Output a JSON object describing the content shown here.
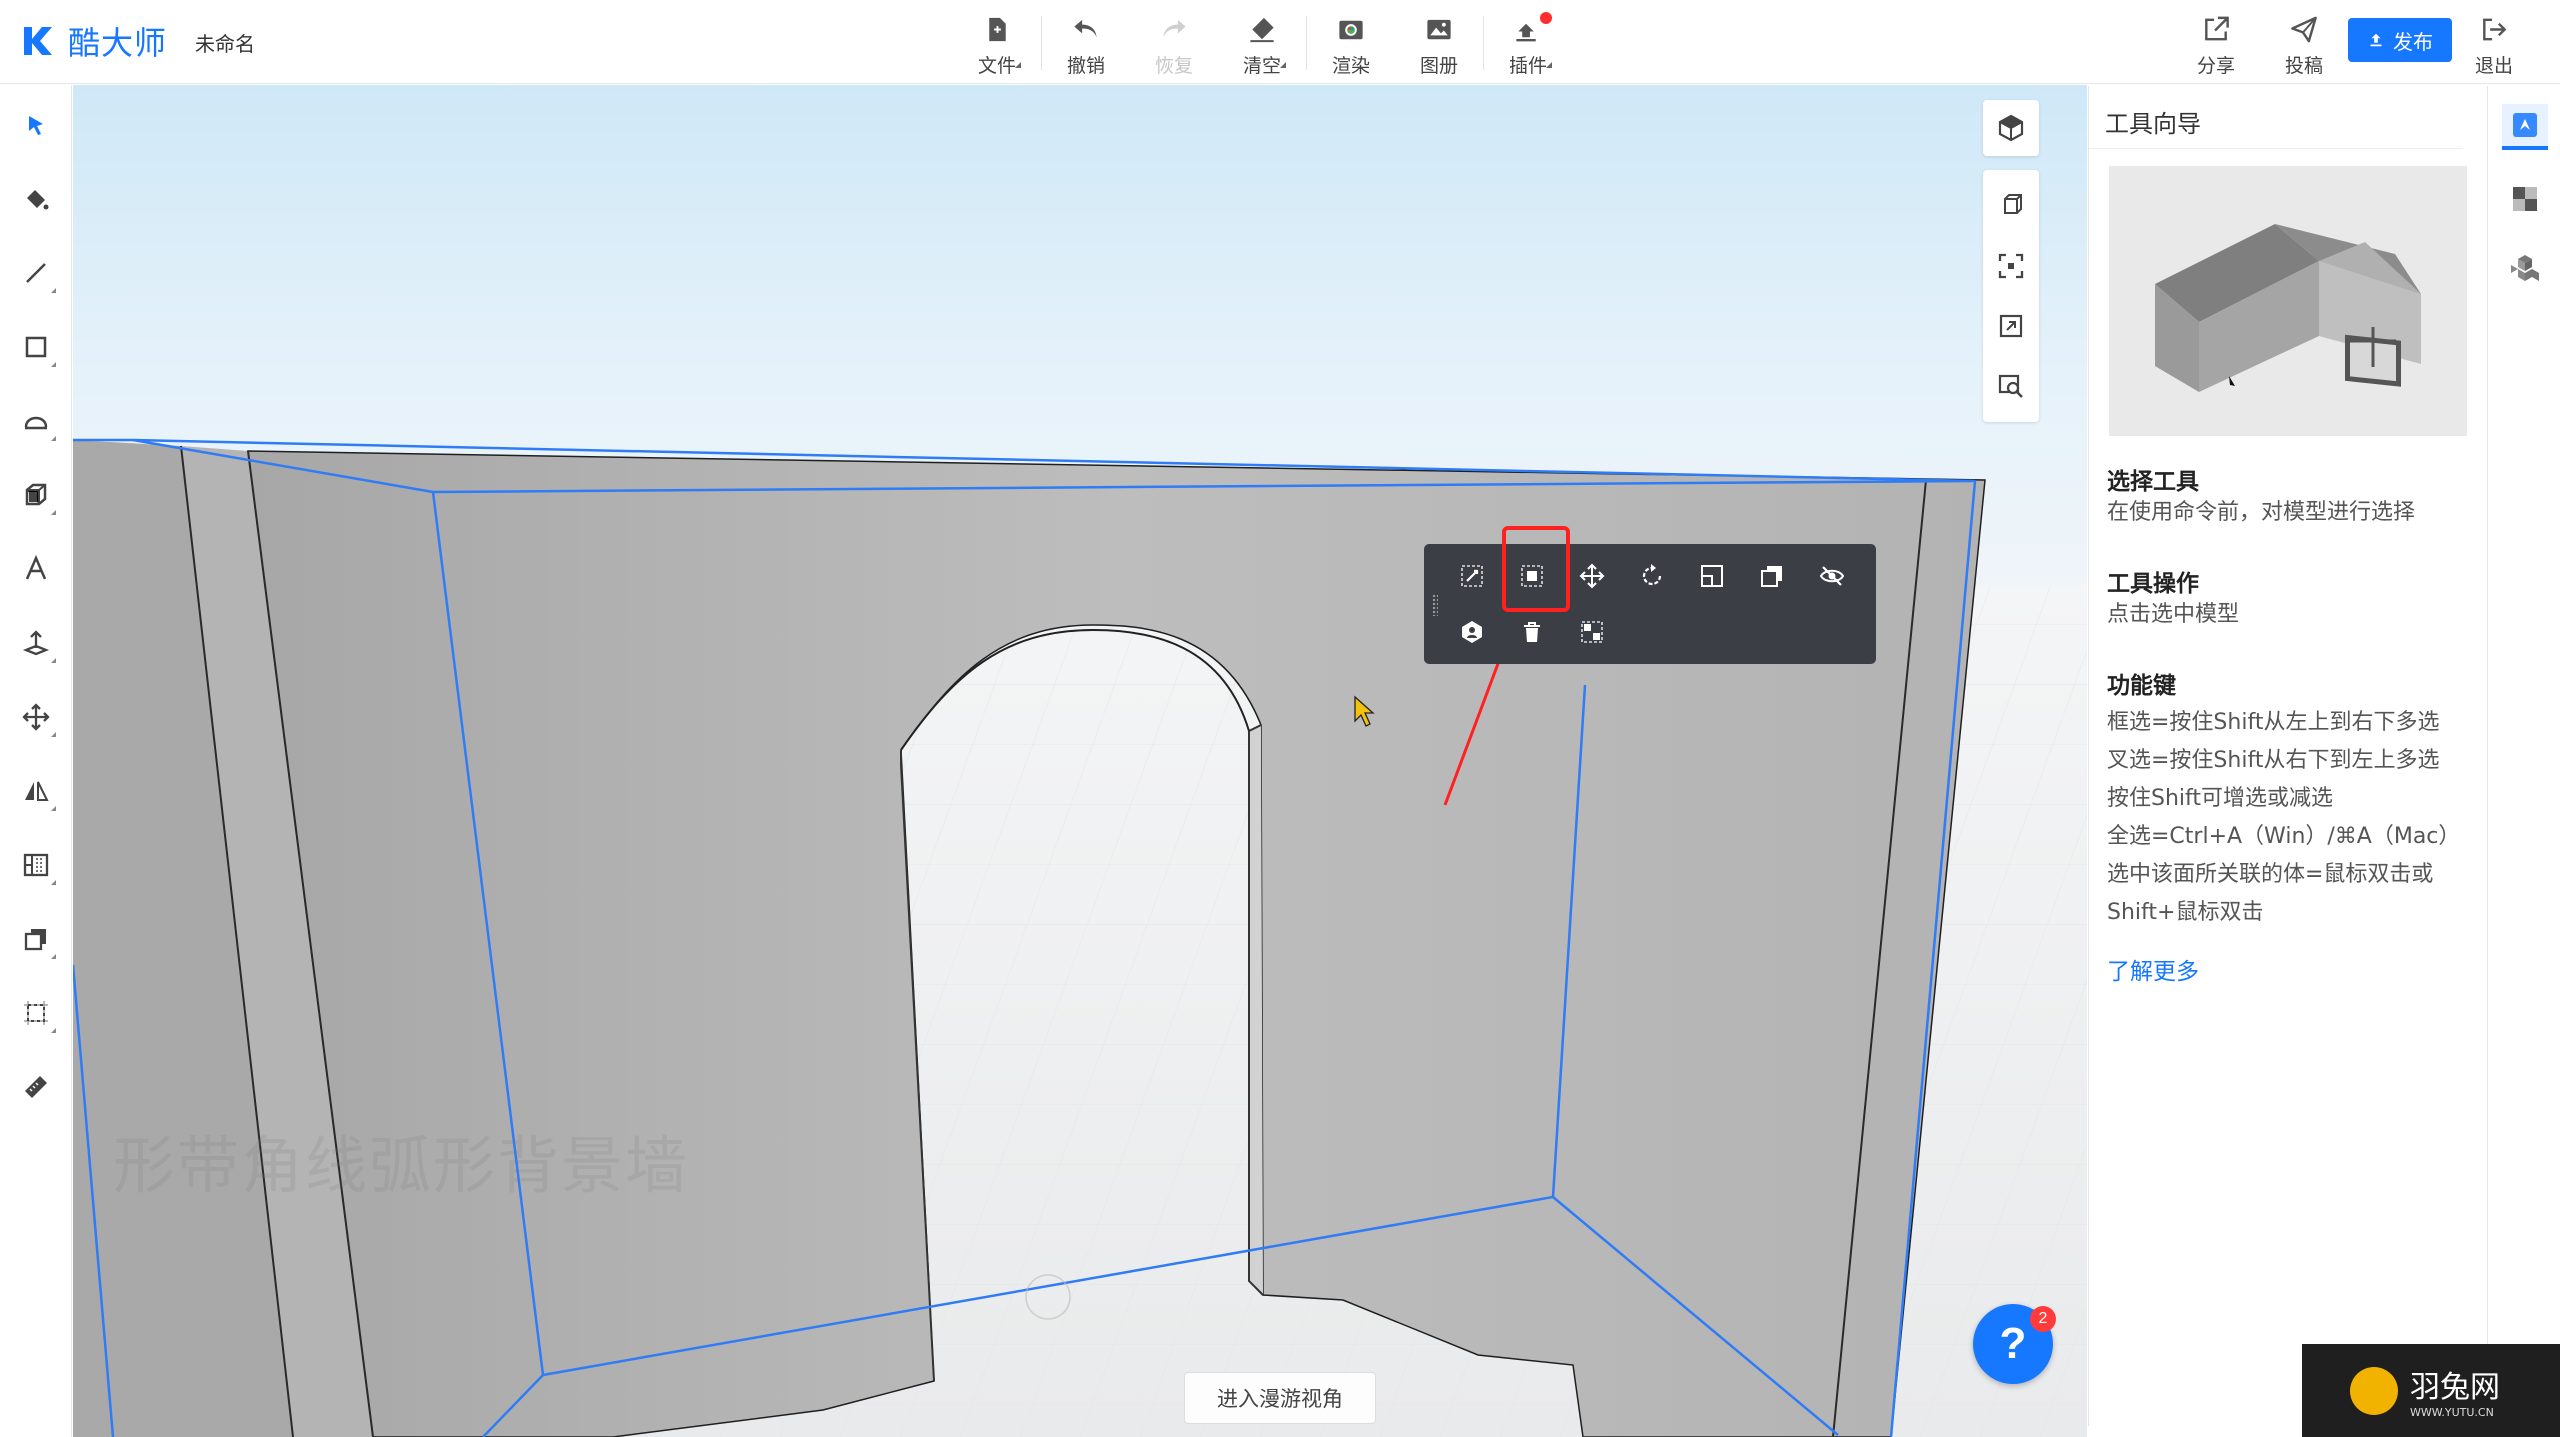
{
  "app": {
    "logo_text": "酷大师",
    "doc_title": "未命名"
  },
  "toolbar": {
    "file": "文件",
    "undo": "撤销",
    "redo": "恢复",
    "clear": "清空",
    "render": "渲染",
    "album": "图册",
    "plugin": "插件",
    "share": "分享",
    "submit": "投稿",
    "publish": "发布",
    "exit": "退出"
  },
  "viewport": {
    "roam_button": "进入漫游视角",
    "caption": "形带角线弧形背景墙",
    "help_glyph": "?",
    "help_badge": "2"
  },
  "panel": {
    "title": "工具向导",
    "section1_title": "选择工具",
    "section1_text": "在使用命令前，对模型进行选择",
    "section2_title": "工具操作",
    "section2_text": "点击选中模型",
    "section3_title": "功能键",
    "section3_lines": [
      "框选=按住Shift从左上到右下多选",
      "叉选=按住Shift从右下到左上多选",
      "按住Shift可增选或减选",
      "全选=Ctrl+A（Win）/⌘A（Mac）",
      "选中该面所关联的体=鼠标双击或",
      "Shift+鼠标双击"
    ],
    "learn_more": "了解更多"
  },
  "site_watermark": {
    "name": "羽兔网",
    "url": "WWW.YUTU.CN"
  },
  "colors": {
    "accent": "#1677ff",
    "highlight": "#ff2020",
    "toolbar_dark": "#3b3f45"
  }
}
